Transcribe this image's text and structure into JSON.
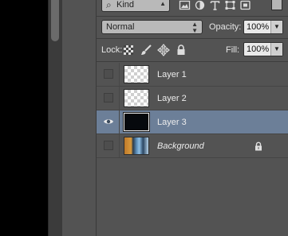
{
  "filter": {
    "kind_label": "Kind",
    "filter_icons": [
      "image-filter-icon",
      "adjustment-filter-icon",
      "type-filter-icon",
      "shape-filter-icon",
      "smart-object-filter-icon"
    ]
  },
  "blend": {
    "mode": "Normal",
    "opacity_label": "Opacity:",
    "opacity_value": "100%"
  },
  "lock": {
    "label": "Lock:",
    "icons": [
      "lock-transparent-pixels-icon",
      "lock-image-pixels-icon",
      "lock-position-icon",
      "lock-all-icon"
    ],
    "fill_label": "Fill:",
    "fill_value": "100%"
  },
  "layers": [
    {
      "name": "Layer 1",
      "visible": false,
      "thumbnail": "transparent"
    },
    {
      "name": "Layer 2",
      "visible": false,
      "thumbnail": "transparent"
    },
    {
      "name": "Layer 3",
      "visible": true,
      "selected": true,
      "thumbnail": "dark"
    },
    {
      "name": "Background",
      "visible": false,
      "thumbnail": "photo",
      "locked": true
    }
  ],
  "colors": {
    "panel_bg": "#535353",
    "selected_row": "#6c7f98",
    "canvas": "#000000"
  }
}
